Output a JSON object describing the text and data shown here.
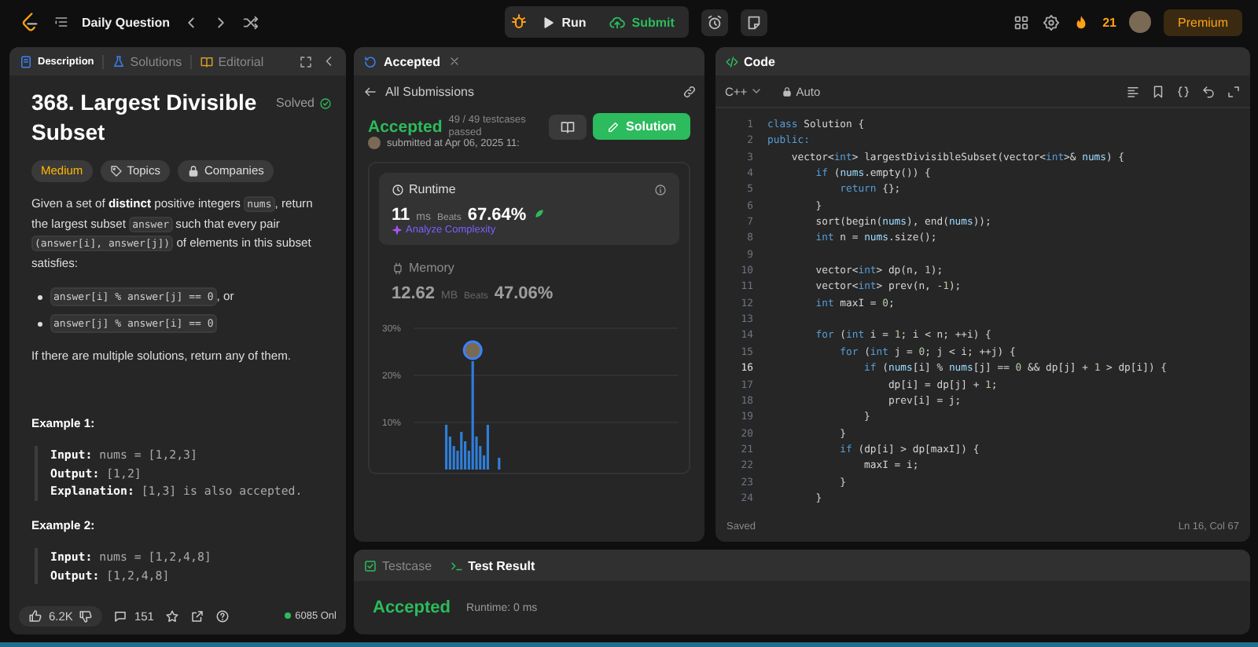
{
  "topbar": {
    "title": "Daily Question",
    "run": "Run",
    "submit": "Submit",
    "streak": "21",
    "premium": "Premium"
  },
  "description_panel": {
    "tabs": [
      {
        "label": "Description",
        "kind": "doc",
        "selected": true
      },
      {
        "label": "Solutions",
        "kind": "flask",
        "selected": false
      },
      {
        "label": "Editorial",
        "kind": "book",
        "selected": false
      }
    ],
    "problem_title": "368. Largest Divisible Subset",
    "status": "Solved",
    "tags": [
      {
        "label": "Medium",
        "kind": "difficulty"
      },
      {
        "label": "Topics",
        "kind": "topics"
      },
      {
        "label": "Companies",
        "kind": "companies"
      }
    ],
    "paragraph": [
      {
        "kind": "text",
        "text": "Given a set of "
      },
      {
        "kind": "bold",
        "text": "distinct"
      },
      {
        "kind": "text",
        "text": " positive integers "
      },
      {
        "kind": "code",
        "text": "nums"
      },
      {
        "kind": "text",
        "text": ", return the largest subset "
      },
      {
        "kind": "code",
        "text": "answer"
      },
      {
        "kind": "text",
        "text": " such that every pair "
      },
      {
        "kind": "code",
        "text": "(answer[i], answer[j])"
      },
      {
        "kind": "text",
        "text": " of elements in this subset satisfies:"
      }
    ],
    "bullets": [
      [
        {
          "kind": "code",
          "text": "answer[i] % answer[j] == 0"
        },
        {
          "kind": "text",
          "text": ", or"
        }
      ],
      [
        {
          "kind": "code",
          "text": "answer[j] % answer[i] == 0"
        }
      ]
    ],
    "note": "If there are multiple solutions, return any of them.",
    "examples": [
      {
        "title": "Example 1:",
        "lines": [
          {
            "label": "Input:",
            "value": "nums = [1,2,3]"
          },
          {
            "label": "Output:",
            "value": "[1,2]"
          },
          {
            "label": "Explanation:",
            "value": "[1,3] is also accepted."
          }
        ]
      },
      {
        "title": "Example 2:",
        "lines": [
          {
            "label": "Input:",
            "value": "nums = [1,2,4,8]"
          },
          {
            "label": "Output:",
            "value": "[1,2,4,8]"
          }
        ]
      }
    ],
    "footer": {
      "likes": "6.2K",
      "comments": "151",
      "online": "6085 Onl"
    }
  },
  "submission_panel": {
    "tab": "Accepted",
    "back": "All Submissions",
    "verdict": "Accepted",
    "testcases": "49 / 49 testcases passed",
    "submitted": "submitted at Apr 06, 2025 11:",
    "solution_button": "Solution",
    "runtime": {
      "label": "Runtime",
      "value": "11",
      "unit": "ms",
      "beats_label": "Beats",
      "beats": "67.64%",
      "analyze": "Analyze Complexity"
    },
    "memory": {
      "label": "Memory",
      "value": "12.62",
      "unit": "MB",
      "beats_label": "Beats",
      "beats": "47.06%"
    },
    "distribution_axis_labels": [
      "30%",
      "20%",
      "10%"
    ]
  },
  "code_panel": {
    "title": "Code",
    "language": "C++",
    "mode": "Auto",
    "saved": "Saved",
    "cursor": "Ln 16, Col 67",
    "lines": [
      {
        "number": "1",
        "current": false,
        "tokens": [
          {
            "kind": "kw",
            "text": "class"
          },
          {
            "kind": "t",
            "text": " Solution {"
          }
        ]
      },
      {
        "number": "2",
        "current": false,
        "tokens": [
          {
            "kind": "kw",
            "text": "public:"
          }
        ]
      },
      {
        "number": "3",
        "current": false,
        "tokens": [
          {
            "kind": "t",
            "text": "    vector<"
          },
          {
            "kind": "kw",
            "text": "int"
          },
          {
            "kind": "t",
            "text": "> largestDivisibleSubset(vector<"
          },
          {
            "kind": "kw",
            "text": "int"
          },
          {
            "kind": "t",
            "text": ">& "
          },
          {
            "kind": "var",
            "text": "nums"
          },
          {
            "kind": "t",
            "text": ") {"
          }
        ]
      },
      {
        "number": "4",
        "current": false,
        "tokens": [
          {
            "kind": "kw",
            "text": "        if"
          },
          {
            "kind": "t",
            "text": " ("
          },
          {
            "kind": "var",
            "text": "nums"
          },
          {
            "kind": "t",
            "text": ".empty()) {"
          }
        ]
      },
      {
        "number": "5",
        "current": false,
        "tokens": [
          {
            "kind": "kw",
            "text": "            return"
          },
          {
            "kind": "t",
            "text": " {};"
          }
        ]
      },
      {
        "number": "6",
        "current": false,
        "tokens": [
          {
            "kind": "t",
            "text": "        }"
          }
        ]
      },
      {
        "number": "7",
        "current": false,
        "tokens": [
          {
            "kind": "t",
            "text": "        sort(begin("
          },
          {
            "kind": "var",
            "text": "nums"
          },
          {
            "kind": "t",
            "text": "), end("
          },
          {
            "kind": "var",
            "text": "nums"
          },
          {
            "kind": "t",
            "text": "));"
          }
        ]
      },
      {
        "number": "8",
        "current": false,
        "tokens": [
          {
            "kind": "kw",
            "text": "        int"
          },
          {
            "kind": "t",
            "text": " n = "
          },
          {
            "kind": "var",
            "text": "nums"
          },
          {
            "kind": "t",
            "text": ".size();"
          }
        ]
      },
      {
        "number": "9",
        "current": false
      },
      {
        "number": "10",
        "current": false,
        "tokens": [
          {
            "kind": "t",
            "text": "        vector<"
          },
          {
            "kind": "kw",
            "text": "int"
          },
          {
            "kind": "t",
            "text": "> dp(n, "
          },
          {
            "kind": "num",
            "text": "1"
          },
          {
            "kind": "t",
            "text": ");"
          }
        ]
      },
      {
        "number": "11",
        "current": false,
        "tokens": [
          {
            "kind": "t",
            "text": "        vector<"
          },
          {
            "kind": "kw",
            "text": "int"
          },
          {
            "kind": "t",
            "text": "> prev(n, -"
          },
          {
            "kind": "num",
            "text": "1"
          },
          {
            "kind": "t",
            "text": ");"
          }
        ]
      },
      {
        "number": "12",
        "current": false,
        "tokens": [
          {
            "kind": "kw",
            "text": "        int"
          },
          {
            "kind": "t",
            "text": " maxI = "
          },
          {
            "kind": "num",
            "text": "0"
          },
          {
            "kind": "t",
            "text": ";"
          }
        ]
      },
      {
        "number": "13",
        "current": false
      },
      {
        "number": "14",
        "current": false,
        "tokens": [
          {
            "kind": "kw",
            "text": "        for"
          },
          {
            "kind": "t",
            "text": " ("
          },
          {
            "kind": "kw",
            "text": "int"
          },
          {
            "kind": "t",
            "text": " i = "
          },
          {
            "kind": "num",
            "text": "1"
          },
          {
            "kind": "t",
            "text": "; i < n; ++i) {"
          }
        ]
      },
      {
        "number": "15",
        "current": false,
        "tokens": [
          {
            "kind": "kw",
            "text": "            for"
          },
          {
            "kind": "t",
            "text": " ("
          },
          {
            "kind": "kw",
            "text": "int"
          },
          {
            "kind": "t",
            "text": " j = "
          },
          {
            "kind": "num",
            "text": "0"
          },
          {
            "kind": "t",
            "text": "; j < i; ++j) {"
          }
        ]
      },
      {
        "number": "16",
        "current": true,
        "tokens": [
          {
            "kind": "kw",
            "text": "                if"
          },
          {
            "kind": "t",
            "text": " ("
          },
          {
            "kind": "var",
            "text": "nums"
          },
          {
            "kind": "t",
            "text": "[i] % "
          },
          {
            "kind": "var",
            "text": "nums"
          },
          {
            "kind": "t",
            "text": "[j] == "
          },
          {
            "kind": "num",
            "text": "0"
          },
          {
            "kind": "t",
            "text": " && dp[j] + "
          },
          {
            "kind": "num",
            "text": "1"
          },
          {
            "kind": "t",
            "text": " > dp[i]) {"
          }
        ]
      },
      {
        "number": "17",
        "current": false,
        "tokens": [
          {
            "kind": "t",
            "text": "                    dp[i] = dp[j] + "
          },
          {
            "kind": "num",
            "text": "1"
          },
          {
            "kind": "t",
            "text": ";"
          }
        ]
      },
      {
        "number": "18",
        "current": false,
        "tokens": [
          {
            "kind": "t",
            "text": "                    prev[i] = j;"
          }
        ]
      },
      {
        "number": "19",
        "current": false,
        "tokens": [
          {
            "kind": "t",
            "text": "                }"
          }
        ]
      },
      {
        "number": "20",
        "current": false,
        "tokens": [
          {
            "kind": "t",
            "text": "            }"
          }
        ]
      },
      {
        "number": "21",
        "current": false,
        "tokens": [
          {
            "kind": "kw",
            "text": "            if"
          },
          {
            "kind": "t",
            "text": " (dp[i] > dp[maxI]) {"
          }
        ]
      },
      {
        "number": "22",
        "current": false,
        "tokens": [
          {
            "kind": "t",
            "text": "                maxI = i;"
          }
        ]
      },
      {
        "number": "23",
        "current": false,
        "tokens": [
          {
            "kind": "t",
            "text": "            }"
          }
        ]
      },
      {
        "number": "24",
        "current": false,
        "tokens": [
          {
            "kind": "t",
            "text": "        }"
          }
        ]
      }
    ]
  },
  "result_panel": {
    "tabs": [
      {
        "label": "Testcase",
        "kind": "checkbox",
        "selected": false
      },
      {
        "label": "Test Result",
        "kind": "terminal",
        "selected": true
      }
    ],
    "verdict": "Accepted",
    "runtime": "Runtime: 0 ms"
  }
}
